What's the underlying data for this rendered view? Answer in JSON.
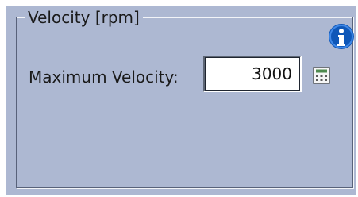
{
  "group": {
    "title": "Velocity [rpm]"
  },
  "field": {
    "label": "Maximum Velocity:",
    "value": "3000"
  },
  "icons": {
    "info": "info-icon",
    "calculator": "calculator-icon"
  },
  "colors": {
    "panel_background": "#adb8d2",
    "info_blue": "#0f57b8"
  }
}
